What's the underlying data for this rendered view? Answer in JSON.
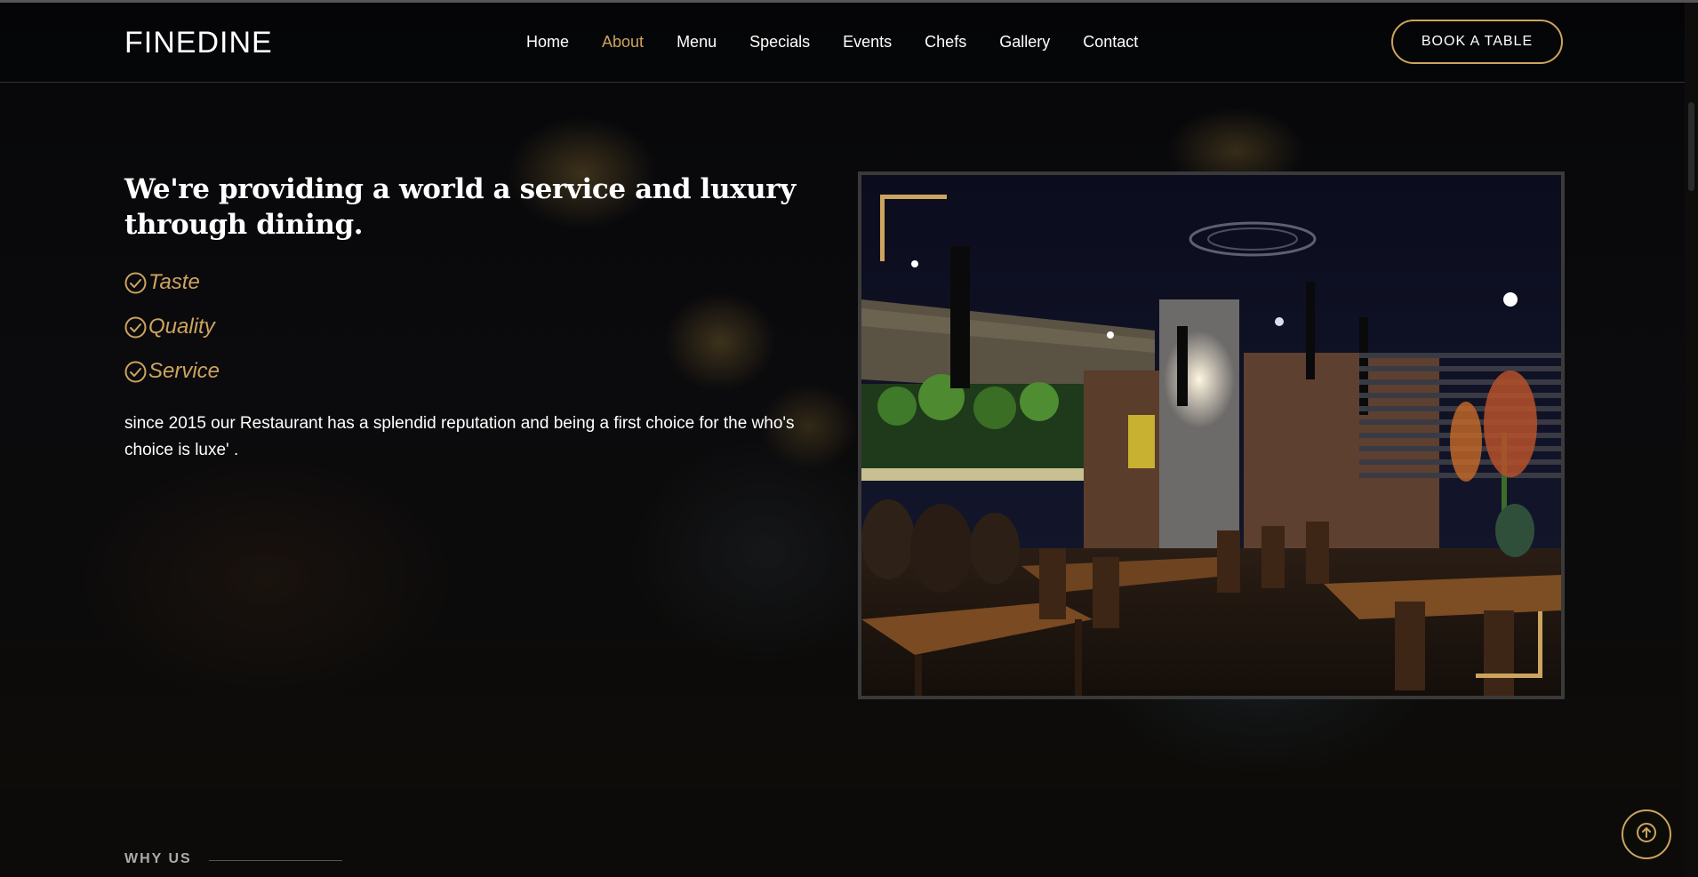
{
  "header": {
    "logo": "FINEDINE",
    "nav": [
      {
        "label": "Home",
        "active": false
      },
      {
        "label": "About",
        "active": true
      },
      {
        "label": "Menu",
        "active": false
      },
      {
        "label": "Specials",
        "active": false
      },
      {
        "label": "Events",
        "active": false
      },
      {
        "label": "Chefs",
        "active": false
      },
      {
        "label": "Gallery",
        "active": false
      },
      {
        "label": "Contact",
        "active": false
      }
    ],
    "book_button": "BOOK A TABLE"
  },
  "about": {
    "title": "We're providing a world a service and luxury through dining.",
    "checks": [
      {
        "icon": "check-circle-icon",
        "label": "Taste"
      },
      {
        "icon": "check-circle-icon",
        "label": "Quality"
      },
      {
        "icon": "check-circle-icon",
        "label": "Service"
      }
    ],
    "text": "since 2015 our Restaurant has a splendid reputation and being a first choice for the who's choice is luxe' .",
    "image": "restaurant-interior-photo"
  },
  "why_us": {
    "label": "WHY US"
  },
  "back_to_top": {
    "icon": "arrow-up-icon"
  },
  "colors": {
    "accent": "#cda45e",
    "background": "#0c0b09",
    "text": "#ffffff"
  }
}
